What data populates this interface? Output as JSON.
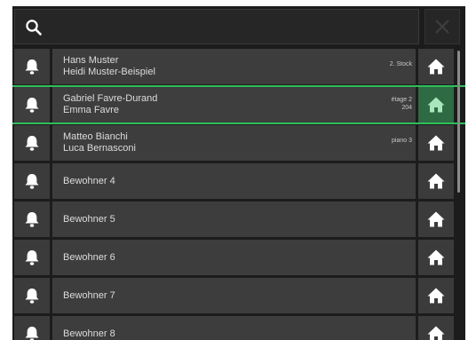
{
  "search": {
    "value": "",
    "placeholder": ""
  },
  "rows": [
    {
      "name_1": "Hans Muster",
      "name_2": "Heidi Muster-Beispiel",
      "floor_1": "2. Stock",
      "floor_2": ""
    },
    {
      "name_1": "Gabriel Favre-Durand",
      "name_2": "Emma Favre",
      "floor_1": "étage 2",
      "floor_2": "204",
      "selected": true
    },
    {
      "name_1": "Matteo Bianchi",
      "name_2": "Luca Bernasconi",
      "floor_1": "piano 3",
      "floor_2": ""
    },
    {
      "name_1": "Bewohner 4",
      "name_2": "",
      "floor_1": "",
      "floor_2": ""
    },
    {
      "name_1": "Bewohner 5",
      "name_2": "",
      "floor_1": "",
      "floor_2": ""
    },
    {
      "name_1": "Bewohner 6",
      "name_2": "",
      "floor_1": "",
      "floor_2": ""
    },
    {
      "name_1": "Bewohner 7",
      "name_2": "",
      "floor_1": "",
      "floor_2": ""
    },
    {
      "name_1": "Bewohner 8",
      "name_2": "",
      "floor_1": "",
      "floor_2": ""
    }
  ],
  "colors": {
    "background": "#1c1c1c",
    "row": "#3d3d3d",
    "accent_green": "#2ebf5a",
    "selected_home": "#2e6a44",
    "text": "#dcdcdc"
  },
  "icons": {
    "search": "search-icon",
    "clear": "close-icon",
    "bell": "bell-icon",
    "home": "home-icon"
  }
}
